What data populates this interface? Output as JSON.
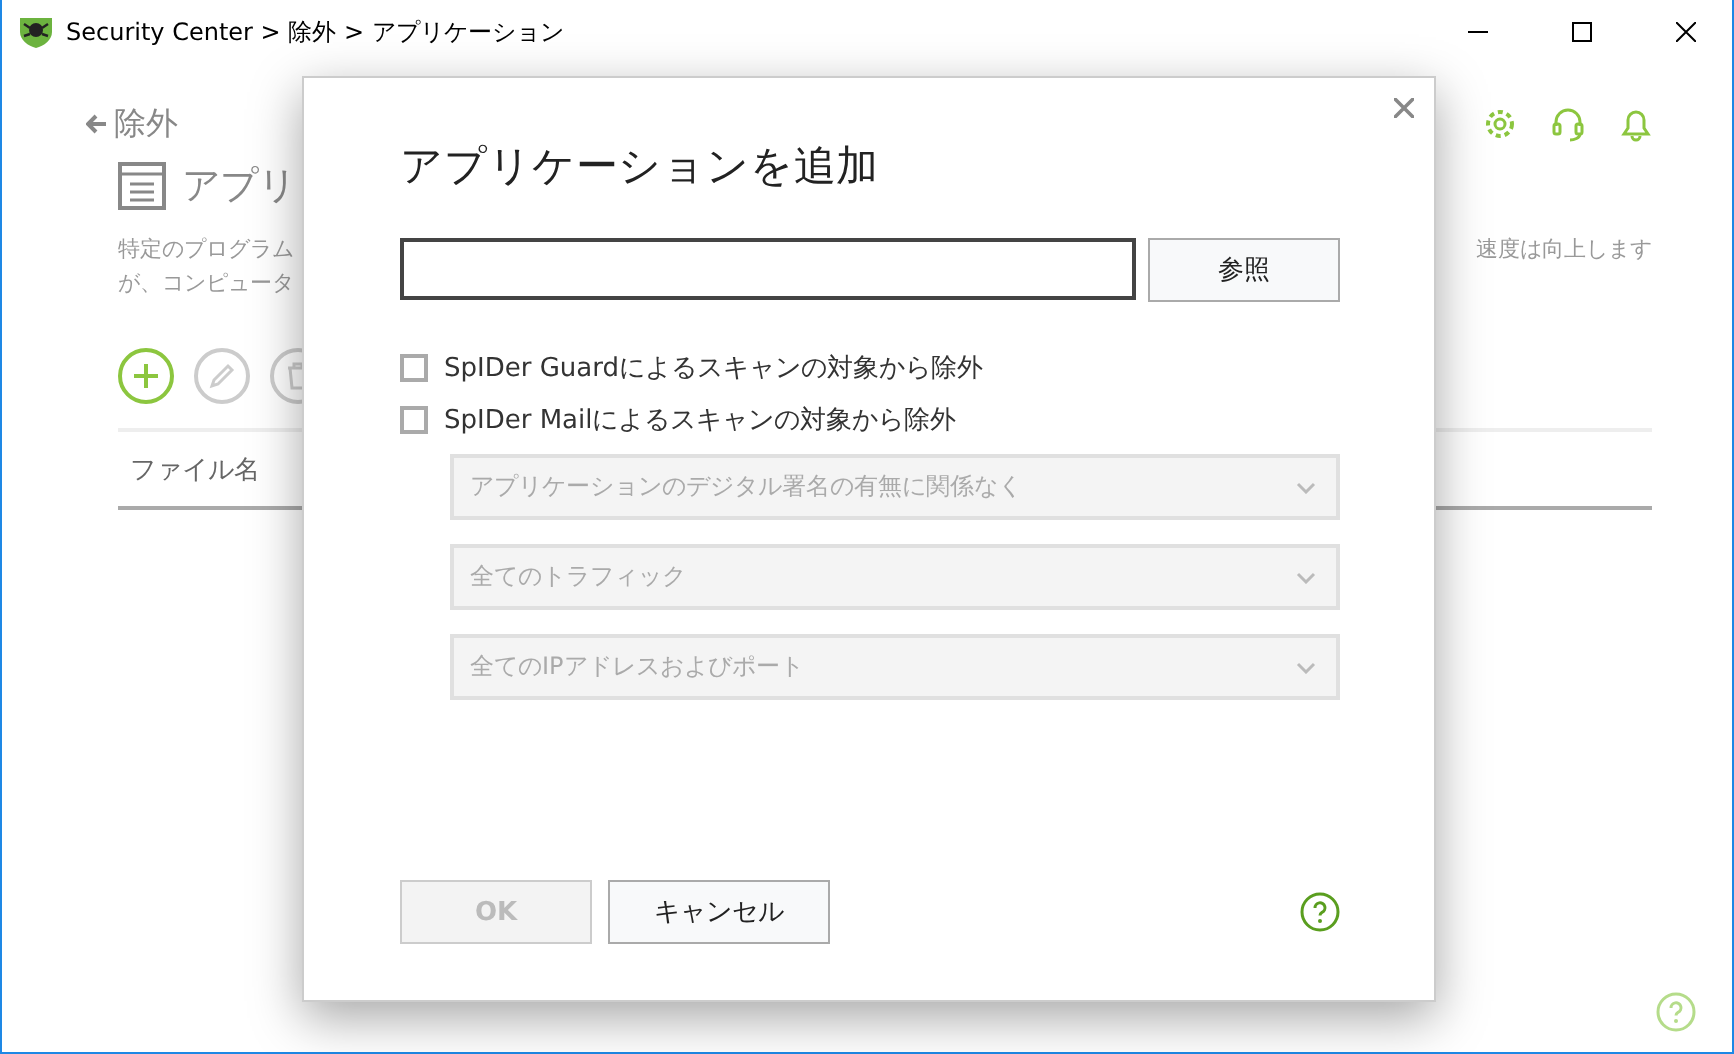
{
  "window": {
    "title": "Security Center > 除外 > アプリケーション"
  },
  "page": {
    "back_link": "除外",
    "heading": "アプリ",
    "description_left": [
      "特定のプログラム",
      "が、コンピュータ"
    ],
    "description_right": "速度は向上します",
    "toolbar": [
      {
        "kind": "add",
        "disabled": false
      },
      {
        "kind": "edit",
        "disabled": true
      },
      {
        "kind": "delete",
        "disabled": true
      }
    ],
    "table": {
      "columns": [
        "ファイル名"
      ]
    }
  },
  "dialog": {
    "title": "アプリケーションを追加",
    "browse_button": "参照",
    "checkboxes": [
      {
        "label": "SpIDer Guardによるスキャンの対象から除外",
        "checked": false
      },
      {
        "label": "SpIDer Mailによるスキャンの対象から除外",
        "checked": false
      }
    ],
    "dropdowns": [
      {
        "value": "アプリケーションのデジタル署名の有無に関係なく",
        "disabled": true
      },
      {
        "value": "全てのトラフィック",
        "disabled": true
      },
      {
        "value": "全てのIPアドレスおよびポート",
        "disabled": true
      }
    ],
    "ok_button": {
      "label": "OK",
      "disabled": true
    },
    "cancel_button": {
      "label": "キャンセル",
      "disabled": false
    }
  }
}
